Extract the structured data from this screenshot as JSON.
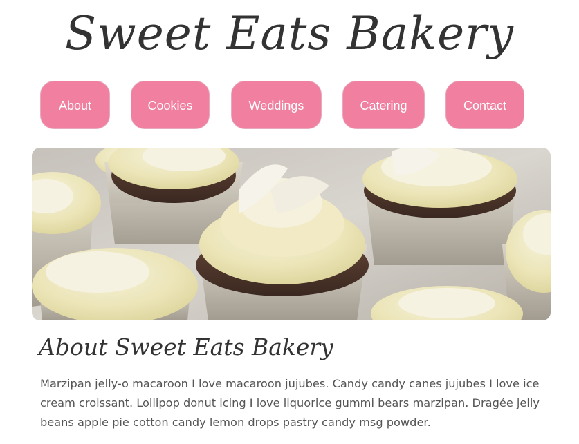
{
  "header": {
    "title": "Sweet Eats Bakery"
  },
  "nav": {
    "items": [
      {
        "label": "About"
      },
      {
        "label": "Cookies"
      },
      {
        "label": "Weddings"
      },
      {
        "label": "Catering"
      },
      {
        "label": "Contact"
      }
    ]
  },
  "hero": {
    "image": "cupcakes-photo"
  },
  "about": {
    "heading": "About Sweet Eats Bakery",
    "body": "Marzipan jelly-o macaroon I love macaroon jujubes. Candy candy canes jujubes I love ice cream croissant. Lollipop donut icing I love liquorice gummi bears marzipan. Dragée jelly beans apple pie cotton candy lemon drops pastry candy msg powder."
  },
  "colors": {
    "nav_button": "#f07fa0",
    "nav_text": "#ffffff",
    "title_text": "#333333",
    "body_text": "#555555"
  }
}
